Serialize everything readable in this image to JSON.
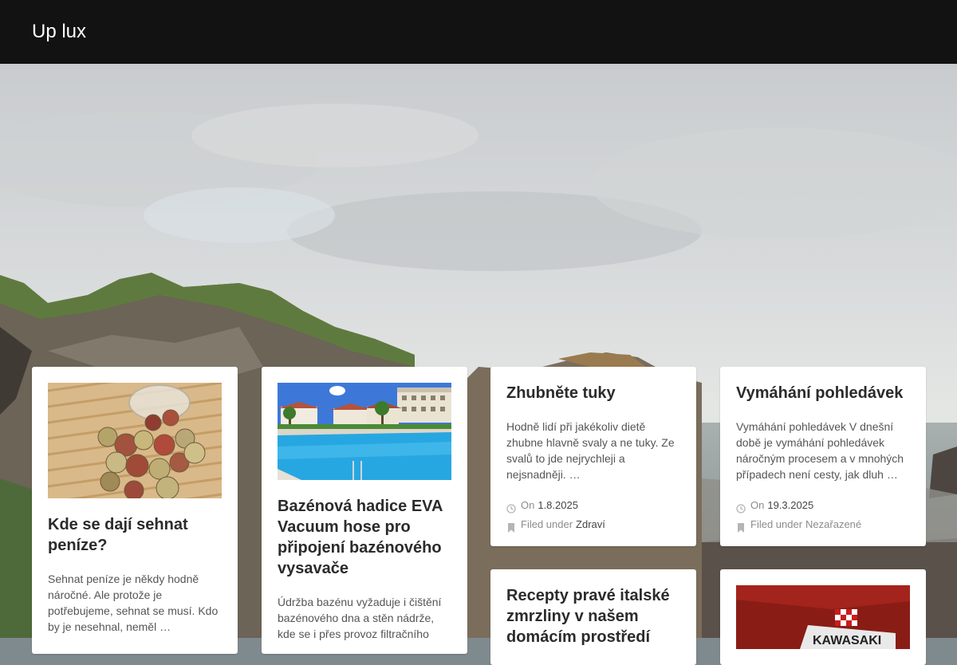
{
  "site": {
    "title": "Up lux"
  },
  "posts": [
    {
      "title": "Kde se dají sehnat peníze?",
      "excerpt": "Sehnat peníze je někdy hodně náročné. Ale protože je potřebujeme, sehnat se musí. Kdo by je nesehnal, neměl …"
    },
    {
      "title": "Bazénová hadice EVA Vacuum hose pro připojení bazénového vysavače",
      "excerpt": "Údržba bazénu vyžaduje i čištění bazénového dna a stěn nádrže, kde se i přes provoz filtračního"
    },
    {
      "title": "Zhubněte tuky",
      "excerpt": "Hodně lidí při jakékoliv dietě zhubne hlavně svaly a ne tuky. Ze svalů to jde nejrychleji a nejsnadněji. …",
      "date_prefix": "On",
      "date": "1.8.2025",
      "category_prefix": "Filed under",
      "category": "Zdraví"
    },
    {
      "title": "Vymáhání pohledávek",
      "excerpt": "Vymáhání pohledávek V dnešní době je vymáhání pohledávek náročným procesem a v mnohých případech není cesty, jak dluh …",
      "date_prefix": "On",
      "date": "19.3.2025",
      "category_prefix": "Filed under",
      "category": "Nezařazené"
    },
    {
      "title": "Recepty pravé italské zmrzliny v našem domácím prostředí"
    },
    {
      "image_text": "KAWASAKI"
    }
  ]
}
